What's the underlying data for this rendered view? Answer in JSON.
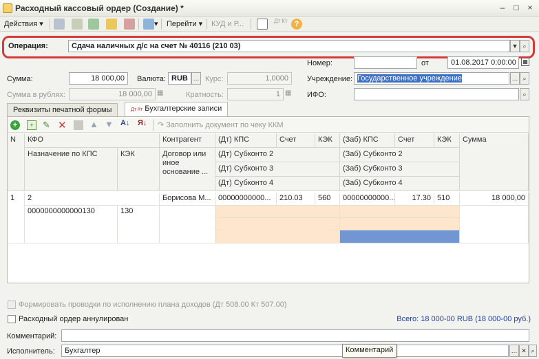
{
  "window": {
    "title": "Расходный кассовый ордер (Создание) *",
    "btn_min": "–",
    "btn_max": "□",
    "btn_close": "×"
  },
  "toolbar": {
    "actions": "Действия",
    "goto": "Перейти",
    "kud": "КУД и Р...",
    "help": "?",
    "dtkt": "Дт Кт"
  },
  "operation": {
    "label": "Операция:",
    "value": "Сдача наличных д/с на счет № 40116 (210 03)"
  },
  "form": {
    "number_label": "Номер:",
    "number_value": "",
    "date_label": "от",
    "date_value": "01.08.2017  0:00:00",
    "sum_label": "Сумма:",
    "sum_value": "18 000,00",
    "currency_label": "Валюта:",
    "currency_value": "RUB",
    "rate_label": "Курс:",
    "rate_value": "1,0000",
    "institution_label": "Учреждение:",
    "institution_value": "Государственное учреждение",
    "sum_rub_label": "Сумма в рублях:",
    "sum_rub_value": "18 000,00",
    "multiplicity_label": "Кратность:",
    "multiplicity_value": "1",
    "ifo_label": "ИФО:",
    "ifo_value": ""
  },
  "tabs": [
    {
      "label": "Реквизиты печатной формы"
    },
    {
      "label": "Бухгалтерские записи"
    }
  ],
  "inner_toolbar": {
    "fill_label": "Заполнить документ по чеку ККМ"
  },
  "table": {
    "headers": {
      "n": "N",
      "kfo": "КФО",
      "purpose": "Назначение по КПС",
      "kek_left": "КЭК",
      "counterparty": "Контрагент",
      "contract": "Договор или иное основание ...",
      "dt_kps": "(Дт) КПС",
      "dt_account": "Счет",
      "dt_kek": "КЭК",
      "dt_sub2": "(Дт) Субконто 2",
      "dt_sub3": "(Дт) Субконто 3",
      "dt_sub4": "(Дт) Субконто 4",
      "kt_kps": "(Заб) КПС",
      "kt_account": "Счет",
      "kt_kek": "КЭК",
      "kt_sub2": "(Заб) Субконто 2",
      "kt_sub3": "(Заб) Субконто 3",
      "kt_sub4": "(Заб) Субконто 4",
      "sum": "Сумма"
    },
    "rows": [
      {
        "n": "1",
        "kfo": "2",
        "purpose": "0000000000000130",
        "kek_left": "130",
        "counterparty": "Борисова М...",
        "dt_kps": "00000000000...",
        "dt_account": "210.03",
        "dt_kek": "560",
        "kt_kps": "00000000000...",
        "kt_account": "17.30",
        "kt_kek": "510",
        "sum": "18 000,00"
      }
    ]
  },
  "footer": {
    "form_entries_label": "Формировать проводки по исполнению плана доходов (Дт 508.00 Кт 507.00)",
    "cancelled_label": "Расходный ордер аннулирован",
    "total": "Всего: 18 000-00 RUB (18 000-00 руб.)",
    "comment_label": "Комментарий:",
    "comment_value": "",
    "executor_label": "Исполнитель:",
    "executor_value": "Бухгалтер",
    "tooltip": "Комментарий"
  },
  "colors": {
    "highlight_frame": "#d63a3a",
    "selection": "#7196d3",
    "peach": "#fde6cc",
    "total_text": "#1f3fa8"
  }
}
